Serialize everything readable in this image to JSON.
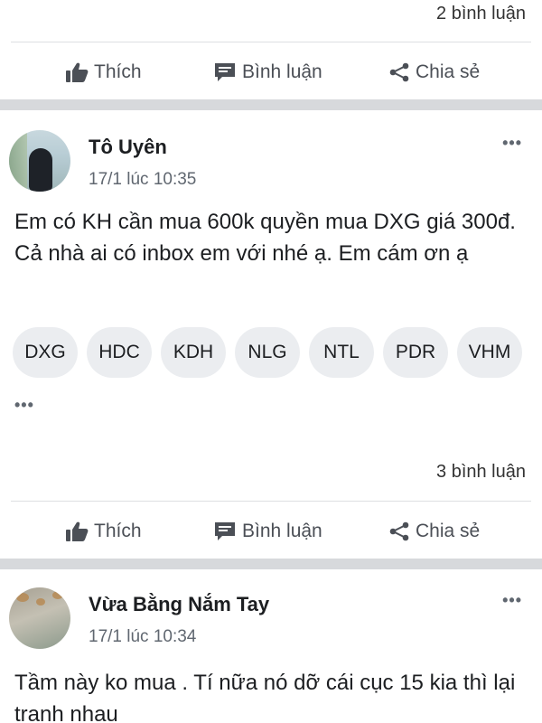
{
  "prev_post": {
    "comments_count": "2 bình luận",
    "actions": {
      "like": "Thích",
      "comment": "Bình luận",
      "share": "Chia sẻ"
    }
  },
  "post1": {
    "author": "Tô Uyên",
    "timestamp": "17/1 lúc 10:35",
    "more": "•••",
    "text": "Em có KH cần mua 600k quyền mua DXG giá 300đ. Cả nhà ai có inbox em với nhé ạ. Em cám ơn ạ",
    "tags": [
      "DXG",
      "HDC",
      "KDH",
      "NLG",
      "NTL",
      "PDR",
      "VHM"
    ],
    "tags_more": "•••",
    "comments_count": "3 bình luận",
    "actions": {
      "like": "Thích",
      "comment": "Bình luận",
      "share": "Chia sẻ"
    }
  },
  "post2": {
    "author": "Vừa Bằng Nắm Tay",
    "timestamp": "17/1 lúc 10:34",
    "more": "•••",
    "text": "Tầm này ko mua . Tí nữa nó dỡ cái cục 15 kia thì lại tranh nhau"
  },
  "colors": {
    "separator": "#d7d9dc",
    "tag_bg": "#ebedf0",
    "secondary_text": "#606770"
  }
}
